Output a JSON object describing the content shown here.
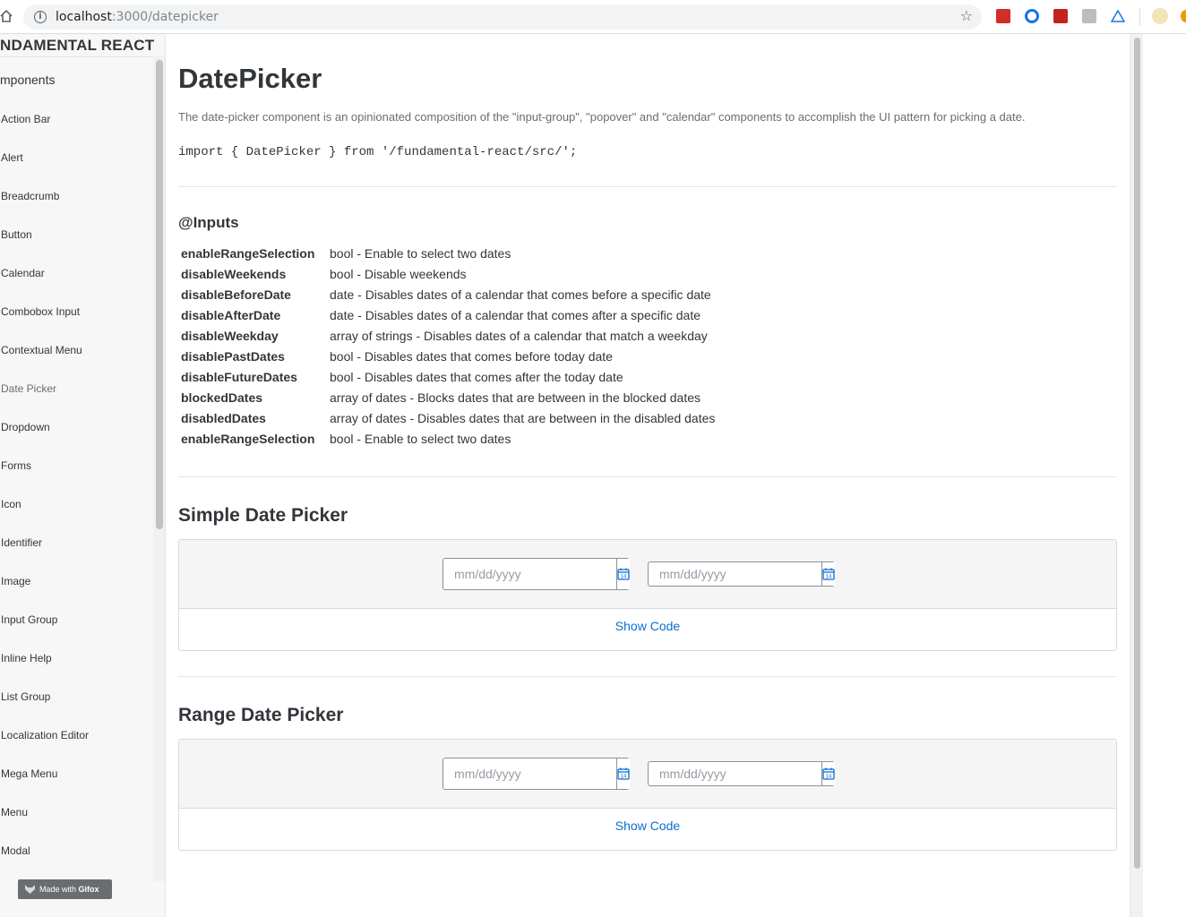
{
  "browser": {
    "url_host": "localhost",
    "url_path": ":3000/datepicker"
  },
  "sidebar": {
    "brand": "NDAMENTAL REACT",
    "heading": "mponents",
    "items": [
      {
        "label": "Action Bar"
      },
      {
        "label": "Alert"
      },
      {
        "label": "Breadcrumb"
      },
      {
        "label": "Button"
      },
      {
        "label": "Calendar"
      },
      {
        "label": "Combobox Input"
      },
      {
        "label": "Contextual Menu"
      },
      {
        "label": "Date Picker",
        "active": true
      },
      {
        "label": "Dropdown"
      },
      {
        "label": "Forms"
      },
      {
        "label": "Icon"
      },
      {
        "label": "Identifier"
      },
      {
        "label": "Image"
      },
      {
        "label": "Input Group"
      },
      {
        "label": "Inline Help"
      },
      {
        "label": "List Group"
      },
      {
        "label": "Localization Editor"
      },
      {
        "label": "Mega Menu"
      },
      {
        "label": "Menu"
      },
      {
        "label": "Modal"
      }
    ]
  },
  "watermark": {
    "prefix": "Made with ",
    "brand": "Gifox"
  },
  "main": {
    "title": "DatePicker",
    "description": "The date-picker component is an opinionated composition of the \"input-group\", \"popover\" and \"calendar\" components to accomplish the UI pattern for picking a date.",
    "import_code": "import { DatePicker } from '/fundamental-react/src/';",
    "inputs_title": "@Inputs",
    "props": [
      {
        "name": "enableRangeSelection",
        "desc": "bool - Enable to select two dates"
      },
      {
        "name": "disableWeekends",
        "desc": "bool - Disable weekends"
      },
      {
        "name": "disableBeforeDate",
        "desc": "date - Disables dates of a calendar that comes before a specific date"
      },
      {
        "name": "disableAfterDate",
        "desc": "date - Disables dates of a calendar that comes after a specific date"
      },
      {
        "name": "disableWeekday",
        "desc": "array of strings - Disables dates of a calendar that match a weekday"
      },
      {
        "name": "disablePastDates",
        "desc": "bool - Disables dates that comes before today date"
      },
      {
        "name": "disableFutureDates",
        "desc": "bool - Disables dates that comes after the today date"
      },
      {
        "name": "blockedDates",
        "desc": "array of dates - Blocks dates that are between in the blocked dates"
      },
      {
        "name": "disabledDates",
        "desc": "array of dates - Disables dates that are between in the disabled dates"
      },
      {
        "name": "enableRangeSelection",
        "desc": "bool - Enable to select two dates"
      }
    ],
    "sections": [
      {
        "title": "Simple Date Picker",
        "placeholder_1": "mm/dd/yyyy",
        "placeholder_2": "mm/dd/yyyy",
        "show_code": "Show Code"
      },
      {
        "title": "Range Date Picker",
        "placeholder_1": "mm/dd/yyyy",
        "placeholder_2": "mm/dd/yyyy",
        "show_code": "Show Code"
      }
    ],
    "calendar_icon_day": "14"
  },
  "colors": {
    "link": "#0a6ed1",
    "text": "#32363a",
    "muted": "#6a6d70"
  }
}
